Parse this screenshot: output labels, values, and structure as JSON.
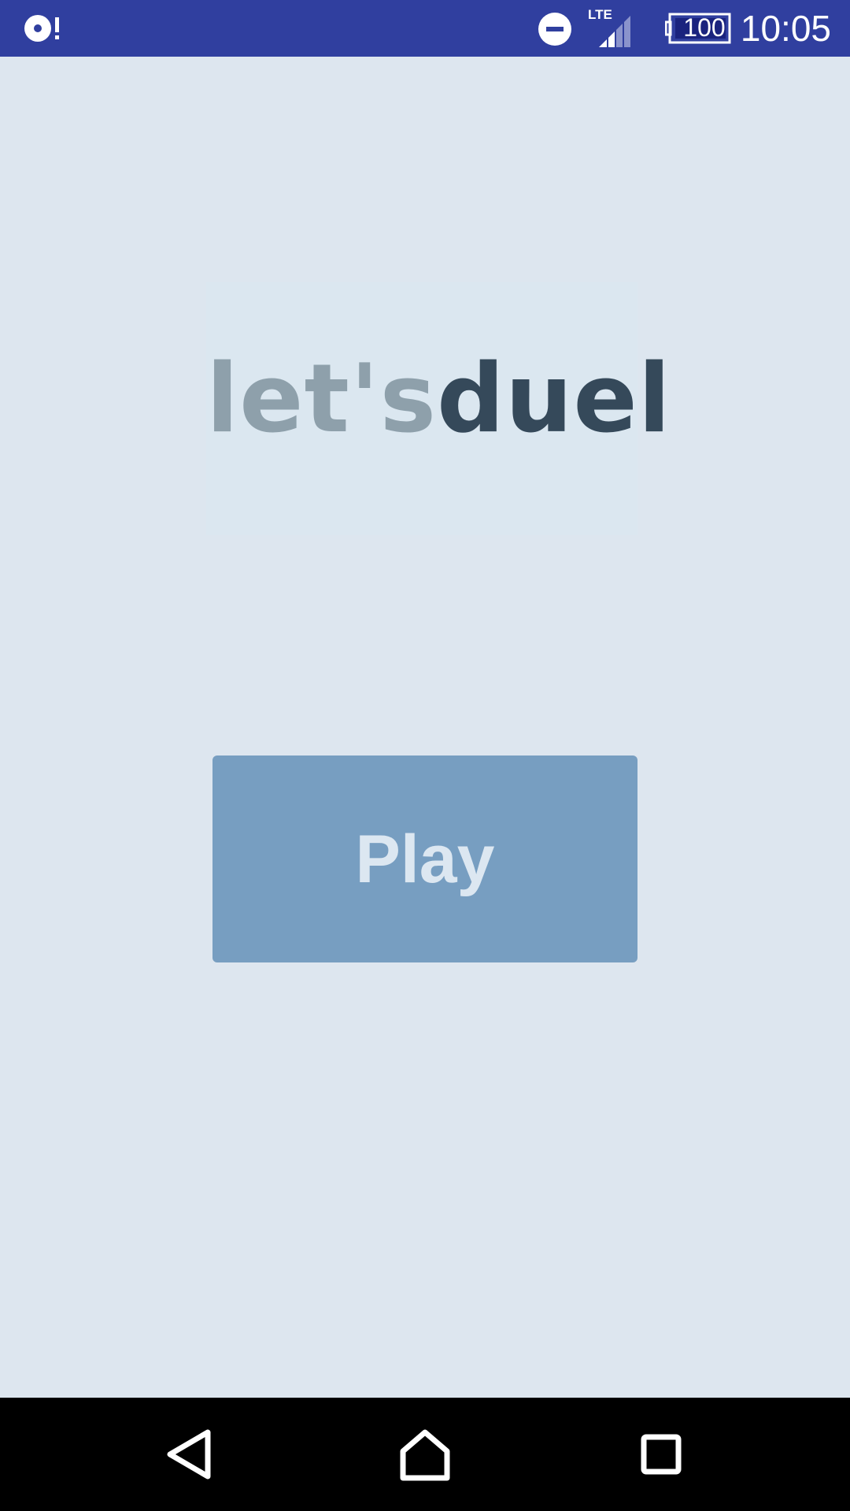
{
  "status_bar": {
    "left_icon": "notification-alert-icon",
    "dnd_icon": "do-not-disturb-icon",
    "network_label": "LTE",
    "signal_icon": "cell-signal-icon",
    "battery_level": "100",
    "time": "10:05",
    "background_color": "#303f9f"
  },
  "logo": {
    "part1": "let's",
    "part2": "duel",
    "part1_color": "#8ea0ab",
    "part2_color": "#35495a"
  },
  "play_button": {
    "label": "Play",
    "background_color": "#779ec1",
    "text_color": "#dce7f1"
  },
  "nav_bar": {
    "back_icon": "back-triangle-icon",
    "home_icon": "home-icon",
    "recents_icon": "recents-square-icon"
  },
  "colors": {
    "background": "#dde6ef"
  }
}
